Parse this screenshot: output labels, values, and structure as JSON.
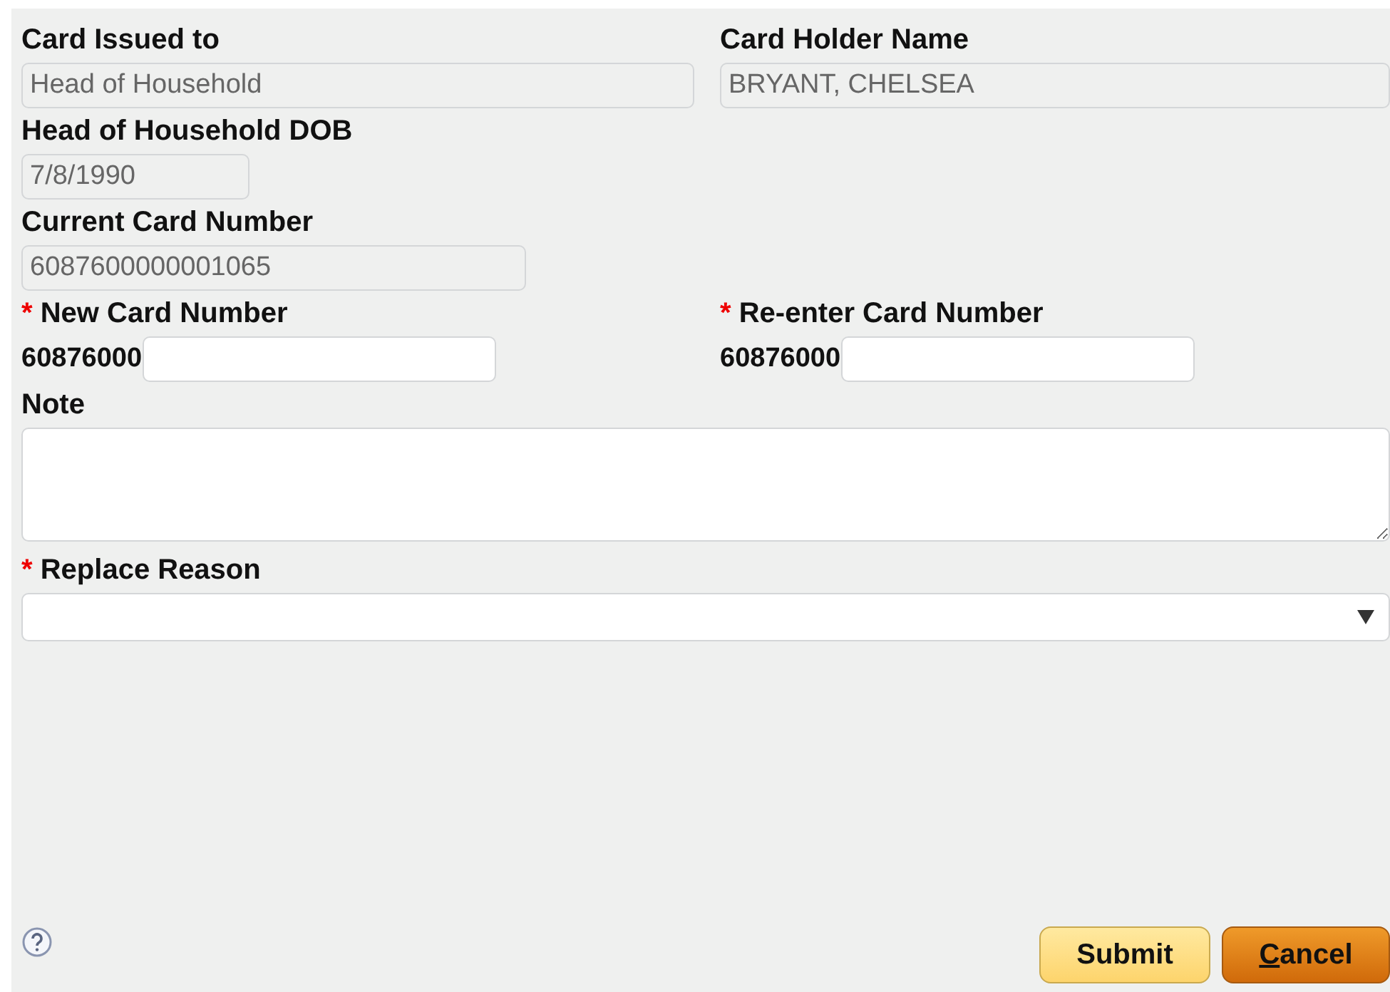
{
  "fields": [
    {
      "kind": "readonly",
      "label": "Card Issued to",
      "value": "Head of Household",
      "required": false
    },
    {
      "kind": "readonly",
      "label": "Card Holder Name",
      "value": "BRYANT, CHELSEA",
      "required": false
    },
    {
      "kind": "readonly",
      "label": "Head of Household DOB",
      "value": "7/8/1990",
      "required": false
    },
    {
      "kind": "spacer"
    },
    {
      "kind": "readonly",
      "label": "Current Card Number",
      "value": "6087600000001065",
      "required": false
    },
    {
      "kind": "spacer"
    },
    {
      "kind": "prefixed",
      "label": "New Card Number",
      "prefix": "60876000",
      "required": true
    },
    {
      "kind": "prefixed",
      "label": "Re-enter Card Number",
      "prefix": "60876000",
      "required": true
    }
  ],
  "required_mark": "*",
  "note": {
    "label": "Note",
    "required": false
  },
  "reason": {
    "label": "Replace Reason",
    "required": true
  },
  "buttons": [
    {
      "label": "Submit",
      "kind": "secondary",
      "access_key_underlined": false
    },
    {
      "label": "Cancel",
      "kind": "primary",
      "access_key_underlined": true
    }
  ]
}
